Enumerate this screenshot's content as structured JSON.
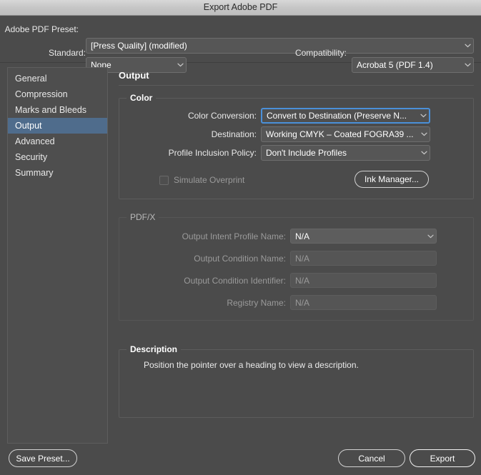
{
  "window": {
    "title": "Export Adobe PDF"
  },
  "top": {
    "preset_label": "Adobe PDF Preset:",
    "preset_value": "[Press Quality] (modified)",
    "standard_label": "Standard:",
    "standard_value": "None",
    "compatibility_label": "Compatibility:",
    "compatibility_value": "Acrobat 5 (PDF 1.4)"
  },
  "sidebar": {
    "items": [
      {
        "label": "General",
        "selected": false
      },
      {
        "label": "Compression",
        "selected": false
      },
      {
        "label": "Marks and Bleeds",
        "selected": false
      },
      {
        "label": "Output",
        "selected": true
      },
      {
        "label": "Advanced",
        "selected": false
      },
      {
        "label": "Security",
        "selected": false
      },
      {
        "label": "Summary",
        "selected": false
      }
    ]
  },
  "main": {
    "panel_title": "Output",
    "color_group": {
      "legend": "Color",
      "color_conversion_label": "Color Conversion:",
      "color_conversion_value": "Convert to Destination (Preserve N...",
      "destination_label": "Destination:",
      "destination_value": "Working CMYK – Coated FOGRA39 ...",
      "profile_policy_label": "Profile Inclusion Policy:",
      "profile_policy_value": "Don't Include Profiles",
      "simulate_overprint_label": "Simulate Overprint",
      "ink_manager_label": "Ink Manager..."
    },
    "pdfx_group": {
      "legend": "PDF/X",
      "output_intent_label": "Output Intent Profile Name:",
      "output_intent_value": "N/A",
      "output_condition_label": "Output Condition Name:",
      "output_condition_value": "N/A",
      "output_condition_id_label": "Output Condition Identifier:",
      "output_condition_id_value": "N/A",
      "registry_label": "Registry Name:",
      "registry_value": "N/A"
    },
    "description_group": {
      "legend": "Description",
      "text": "Position the pointer over a heading to view a description."
    }
  },
  "footer": {
    "save_preset_label": "Save Preset...",
    "cancel_label": "Cancel",
    "export_label": "Export"
  },
  "colors": {
    "dialog_bg": "#4b4b4b",
    "titlebar": "#cdcdcd",
    "selection_blue": "#4f6c8c",
    "focus_blue": "#4a90d9",
    "field_bg": "#565656"
  }
}
